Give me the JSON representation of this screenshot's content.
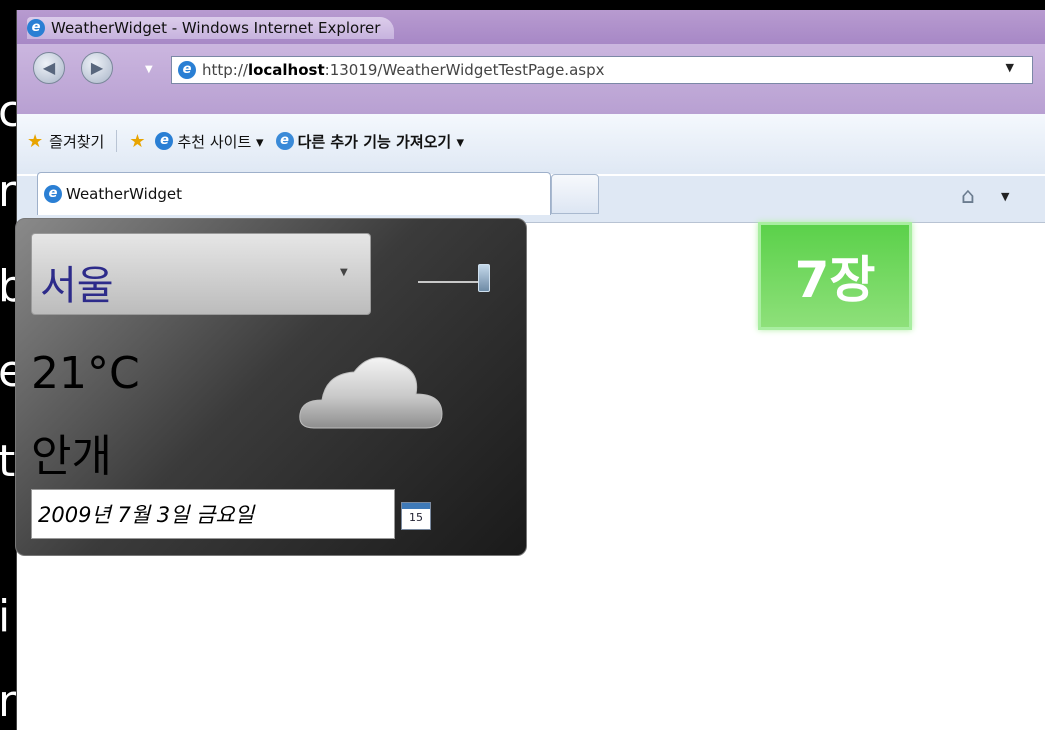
{
  "background_letters": [
    "c",
    "r",
    "b",
    "e",
    "t",
    "i",
    "n"
  ],
  "window": {
    "title": "WeatherWidget - Windows Internet Explorer"
  },
  "address": {
    "url_prefix": "http://",
    "url_host": "localhost",
    "url_rest": ":13019/WeatherWidgetTestPage.aspx"
  },
  "favorites": {
    "favorites_label": "즐겨찾기",
    "suggested_sites": "추천 사이트 ▾",
    "get_addons": "다른 추가 기능 가져오기 ▾"
  },
  "tabs": {
    "active_label": "WeatherWidget"
  },
  "widget": {
    "city": "서울",
    "temperature": "21°C",
    "condition": "안개",
    "date": "2009년 7월 3일 금요일",
    "calendar_day": "15"
  },
  "badge": {
    "label": "7장"
  },
  "colors": {
    "badge_green": "#5bd14a",
    "title_bar": "#b89bd0",
    "city_text": "#2d2b8a"
  }
}
